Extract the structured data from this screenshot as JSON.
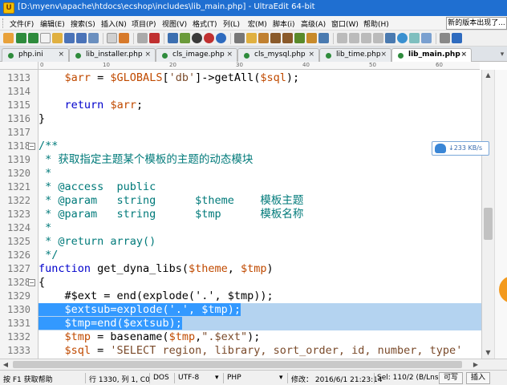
{
  "titlebar": {
    "title": "[D:\\myenv\\apache\\htdocs\\ecshop\\includes\\lib_main.php] - UltraEdit 64-bit",
    "app_glyph": "U"
  },
  "menu": {
    "items": [
      "文件(F)",
      "编辑(E)",
      "搜索(S)",
      "插入(N)",
      "项目(P)",
      "视图(V)",
      "格式(T)",
      "列(L)",
      "宏(M)",
      "脚本(i)",
      "高级(A)",
      "窗口(W)",
      "帮助(H)"
    ]
  },
  "new_version_label": "新的版本出现了...",
  "tabs": [
    {
      "label": "php.ini",
      "close": "×"
    },
    {
      "label": "lib_installer.php",
      "close": "×"
    },
    {
      "label": "cls_image.php",
      "close": "×"
    },
    {
      "label": "cls_mysql.php",
      "close": "×"
    },
    {
      "label": "lib_time.php",
      "close": "×"
    },
    {
      "label": "lib_main.php",
      "close": "×",
      "active": true
    }
  ],
  "tab_overflow": "▾",
  "ruler": {
    "labels": [
      "0",
      "10",
      "20",
      "30",
      "40",
      "50",
      "60"
    ]
  },
  "editor": {
    "lines": [
      {
        "num": "1313",
        "text": "    $arr = $GLOBALS['db']->getAll($sql);"
      },
      {
        "num": "1314",
        "text": ""
      },
      {
        "num": "1315",
        "text": "    return $arr;"
      },
      {
        "num": "1316",
        "text": "}"
      },
      {
        "num": "1317",
        "text": ""
      },
      {
        "num": "1318",
        "text": "/**"
      },
      {
        "num": "1319",
        "text": " * 获取指定主题某个模板的主题的动态模块"
      },
      {
        "num": "1320",
        "text": " *"
      },
      {
        "num": "1321",
        "text": " * @access  public"
      },
      {
        "num": "1322",
        "text": " * @param   string      $theme    模板主题"
      },
      {
        "num": "1323",
        "text": " * @param   string      $tmp      模板名称"
      },
      {
        "num": "1324",
        "text": " *"
      },
      {
        "num": "1325",
        "text": " * @return array()"
      },
      {
        "num": "1326",
        "text": " */"
      },
      {
        "num": "1327",
        "text": "function get_dyna_libs($theme, $tmp)"
      },
      {
        "num": "1328",
        "text": "{"
      },
      {
        "num": "1329",
        "text": "    #$ext = end(explode('.', $tmp));"
      },
      {
        "num": "1330",
        "text": "    $extsub=explode('.', $tmp);"
      },
      {
        "num": "1331",
        "text": "    $tmp=end($extsub);"
      },
      {
        "num": "1332",
        "text": "    $tmp = basename($tmp,\".$ext\");"
      },
      {
        "num": "1333",
        "text": "    $sql = 'SELECT region, library, sort_order, id, number, type'"
      }
    ]
  },
  "network_badge": "↓233 KB/s",
  "status": {
    "help": "按 F1 获取帮助",
    "position": "行 1330, 列 1, C0",
    "line_ending": "DOS",
    "encoding": "UTF-8",
    "language": "PHP",
    "modified": "修改： 2016/6/1 21:23:14",
    "selection": "Sel: 110/2 (B/Lns)",
    "rw": "可写",
    "insert": "插入"
  },
  "colors": {
    "titlebar": "#1f6fd1",
    "variable": "#c04a00",
    "keyword": "#0000cc",
    "comment": "#007a7a",
    "selection_line": "#b4d3f0",
    "selection_text": "#3399ff"
  }
}
